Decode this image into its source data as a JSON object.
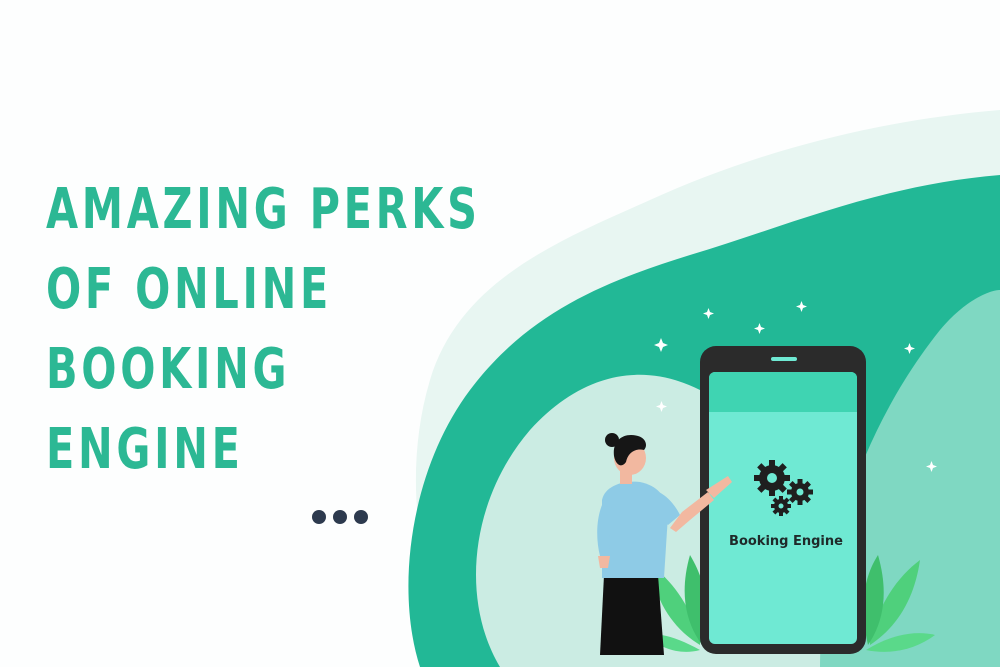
{
  "headline": {
    "lines": [
      "AMAZING PERKS",
      "OF ONLINE",
      "BOOKING",
      "ENGINE"
    ]
  },
  "phone": {
    "screen_label": "Booking Engine"
  },
  "colors": {
    "headline": "#2cb894",
    "dots": "#2d3a4e",
    "blob_light": "#e8f6f2",
    "blob_mid": "#cbece3",
    "blob_dark": "#22b896",
    "screen": "#6fe9d3",
    "phone_frame": "#2b2b2b",
    "gear": "#1f1f1f"
  },
  "icons": [
    "gear-icon",
    "leaf-icon",
    "sparkle-icon",
    "more-dots-icon"
  ]
}
